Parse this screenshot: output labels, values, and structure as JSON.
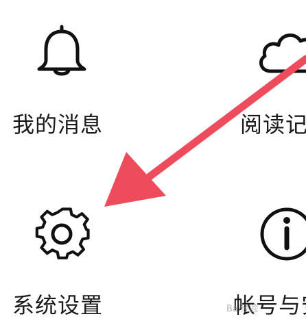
{
  "menu": {
    "items": [
      {
        "label": "我的消息",
        "icon": "bell-icon"
      },
      {
        "label": "阅读记",
        "icon": "cloud-icon"
      },
      {
        "label": "系统设置",
        "icon": "gear-icon"
      },
      {
        "label": "帐号与安",
        "icon": "info-icon"
      }
    ]
  },
  "annotation": {
    "arrow_color": "#ee4b5c",
    "target": "系统设置"
  },
  "watermark": {
    "text": "Bai经验"
  },
  "colors": {
    "icon_stroke": "#111111",
    "label_text": "#1a1a1a",
    "background": "#ffffff"
  }
}
